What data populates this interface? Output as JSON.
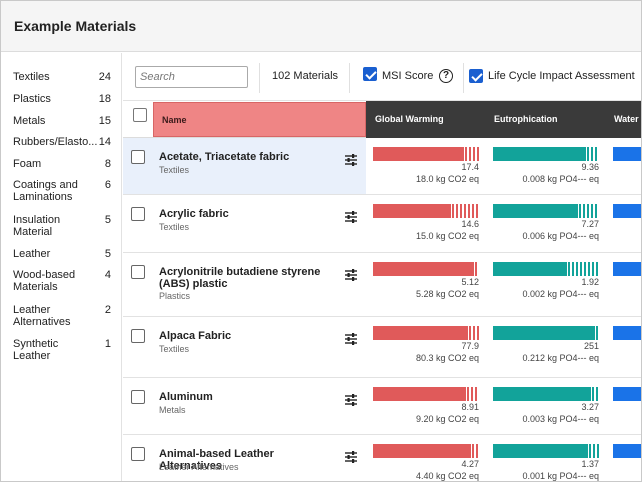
{
  "window": {
    "title": "Example Materials"
  },
  "sidebar": {
    "categories": [
      {
        "label": "Textiles",
        "count": "24"
      },
      {
        "label": "Plastics",
        "count": "18"
      },
      {
        "label": "Metals",
        "count": "15"
      },
      {
        "label": "Rubbers/Elasto...",
        "count": "14"
      },
      {
        "label": "Foam",
        "count": "8"
      },
      {
        "label": "Coatings and Laminations",
        "count": "6"
      },
      {
        "label": "Insulation Material",
        "count": "5"
      },
      {
        "label": "Leather",
        "count": "5"
      },
      {
        "label": "Wood-based Materials",
        "count": "4"
      },
      {
        "label": "Leather Alternatives",
        "count": "2"
      },
      {
        "label": "Synthetic Leather",
        "count": "1"
      }
    ]
  },
  "toolbar": {
    "search_placeholder": "Search",
    "count_label": "102 Materials",
    "msi_label": "MSI Score",
    "msi_checked": true,
    "lca_label": "Life Cycle Impact Assessment",
    "lca_checked": true,
    "help_glyph": "?"
  },
  "table": {
    "columns": {
      "name": "Name",
      "gw": "Global Warming",
      "eu": "Eutrophication",
      "water": "Water"
    },
    "colors": {
      "gw": "#e05a5a",
      "eu": "#12a39a",
      "water": "#1a73e8",
      "header_bg": "#3a3a3a",
      "name_highlight": "#ef8585"
    },
    "rows": [
      {
        "name": "Acetate, Triacetate fabric",
        "category": "Textiles",
        "selected": true,
        "gw_value": "17.4",
        "gw_unit": "18.0 kg CO2 eq",
        "gw_fill": 0.86,
        "eu_value": "9.36",
        "eu_unit": "0.008 kg PO4--- eq",
        "eu_fill": 0.88
      },
      {
        "name": "Acrylic fabric",
        "category": "Textiles",
        "selected": false,
        "gw_value": "14.6",
        "gw_unit": "15.0 kg CO2 eq",
        "gw_fill": 0.74,
        "eu_value": "7.27",
        "eu_unit": "0.006 kg PO4--- eq",
        "eu_fill": 0.8
      },
      {
        "name": "Acrylonitrile butadiene styrene (ABS) plastic",
        "category": "Plastics",
        "selected": false,
        "gw_value": "5.12",
        "gw_unit": "5.28 kg CO2 eq",
        "gw_fill": 0.95,
        "eu_value": "1.92",
        "eu_unit": "0.002 kg PO4--- eq",
        "eu_fill": 0.7
      },
      {
        "name": "Alpaca Fabric",
        "category": "Textiles",
        "selected": false,
        "gw_value": "77.9",
        "gw_unit": "80.3 kg CO2 eq",
        "gw_fill": 0.9,
        "eu_value": "251",
        "eu_unit": "0.212 kg PO4--- eq",
        "eu_fill": 0.96
      },
      {
        "name": "Aluminum",
        "category": "Metals",
        "selected": false,
        "gw_value": "8.91",
        "gw_unit": "9.20 kg CO2 eq",
        "gw_fill": 0.88,
        "eu_value": "3.27",
        "eu_unit": "0.003 kg PO4--- eq",
        "eu_fill": 0.92
      },
      {
        "name": "Animal-based Leather Alternatives",
        "category": "Leather Alternatives",
        "selected": false,
        "gw_value": "4.27",
        "gw_unit": "4.40 kg CO2 eq",
        "gw_fill": 0.92,
        "eu_value": "1.37",
        "eu_unit": "0.001 kg PO4--- eq",
        "eu_fill": 0.9
      }
    ]
  }
}
